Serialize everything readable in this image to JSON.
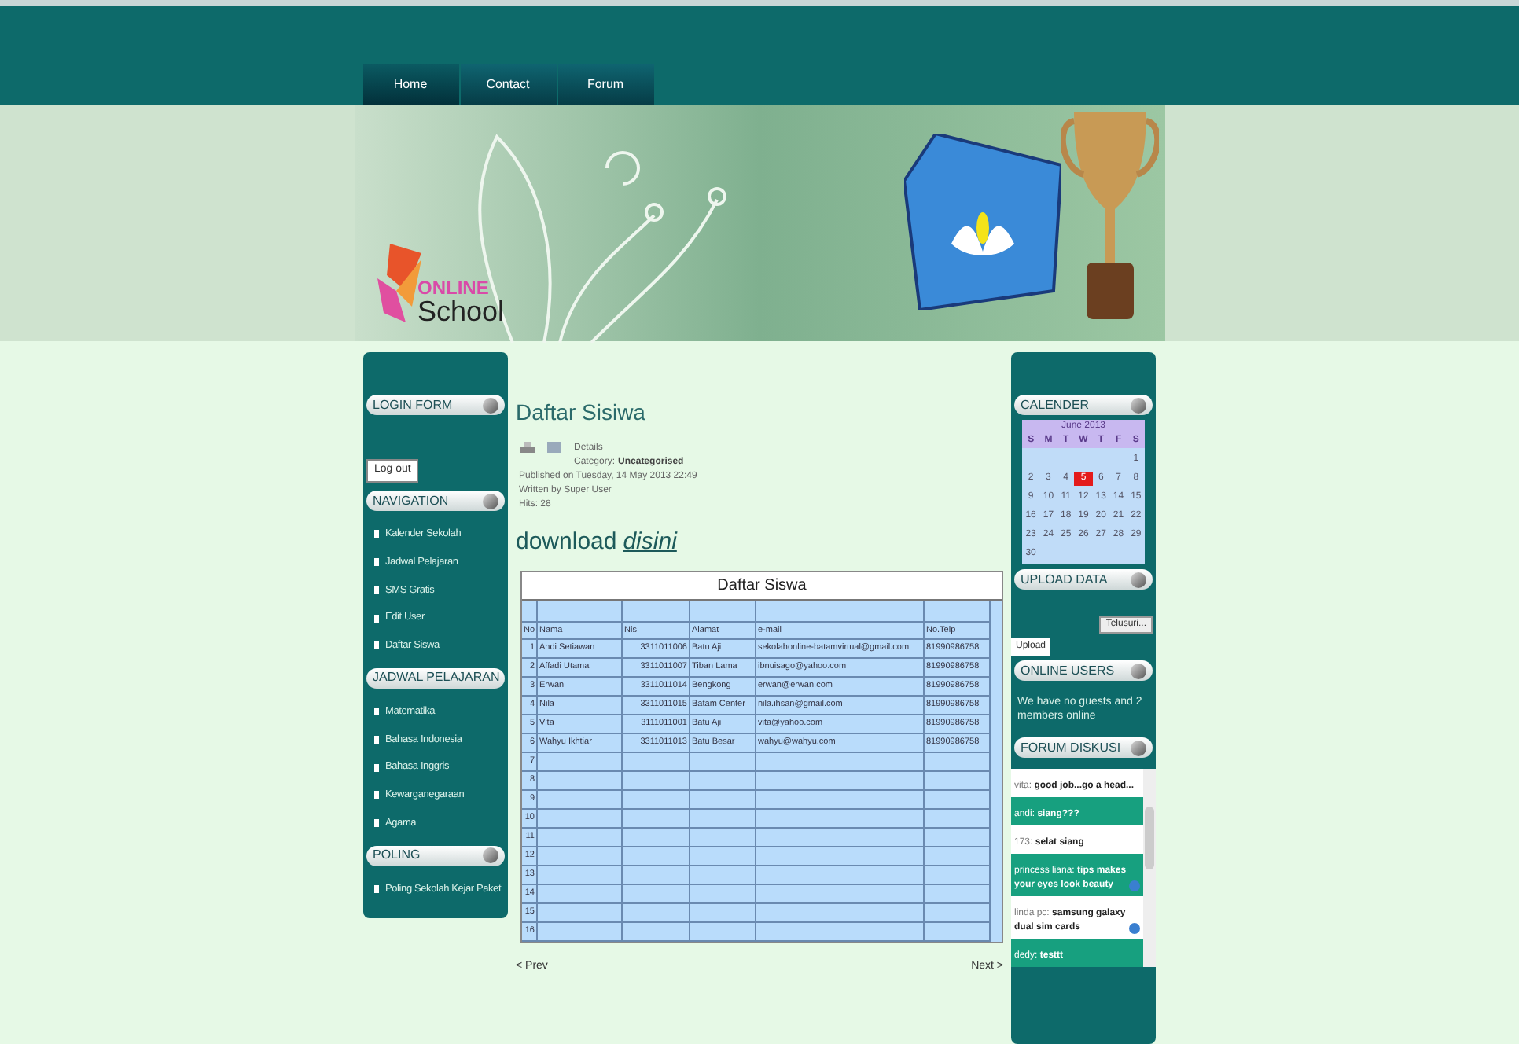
{
  "nav": [
    {
      "label": "Home",
      "selected": true
    },
    {
      "label": "Contact",
      "selected": false
    },
    {
      "label": "Forum",
      "selected": false
    }
  ],
  "logo": {
    "word_1": "ONLINE",
    "word_2": "School"
  },
  "left_modules": [
    {
      "title": "LOGIN FORM",
      "kind": "login",
      "button": "Log out"
    },
    {
      "title": "NAVIGATION",
      "kind": "links",
      "items": [
        "Kalender Sekolah",
        "Jadwal Pelajaran",
        "SMS Gratis",
        "Edit User",
        "Daftar Siswa"
      ]
    },
    {
      "title": "JADWAL PELAJARAN",
      "kind": "links",
      "items": [
        "Matematika",
        "Bahasa Indonesia",
        "Bahasa Inggris",
        "Kewarganegaraan",
        "Agama"
      ]
    },
    {
      "title": "POLING",
      "kind": "links",
      "items": [
        "Poling Sekolah Kejar Paket"
      ]
    }
  ],
  "article": {
    "title": "Daftar Sisiwa",
    "details_label": "Details",
    "category_label": "Category:",
    "category": "Uncategorised",
    "published": "Published on Tuesday, 14 May 2013 22:49",
    "author": "Written by Super User",
    "hits": "Hits: 28",
    "download_text": "download",
    "download_link": "disini"
  },
  "table": {
    "title": "Daftar Siswa",
    "columns": [
      "No",
      "Nama",
      "Nis",
      "Alamat",
      "e-mail",
      "No.Telp"
    ],
    "rows": [
      [
        "1",
        "Andi Setiawan",
        "3311011006",
        "Batu Aji",
        "sekolahonline-batamvirtual@gmail.com",
        "81990986758"
      ],
      [
        "2",
        "Affadi Utama",
        "3311011007",
        "Tiban Lama",
        "ibnuisago@yahoo.com",
        "81990986758"
      ],
      [
        "3",
        "Erwan",
        "3311011014",
        "Bengkong",
        "erwan@erwan.com",
        "81990986758"
      ],
      [
        "4",
        "Nila",
        "3311011015",
        "Batam Center",
        "nila.ihsan@gmail.com",
        "81990986758"
      ],
      [
        "5",
        "Vita",
        "3111011001",
        "Batu Aji",
        "vita@yahoo.com",
        "81990986758"
      ],
      [
        "6",
        "Wahyu Ikhtiar",
        "3311011013",
        "Batu Besar",
        "wahyu@wahyu.com",
        "81990986758"
      ],
      [
        "7"
      ],
      [
        "8"
      ],
      [
        "9"
      ],
      [
        "10"
      ],
      [
        "11"
      ],
      [
        "12"
      ],
      [
        "13"
      ],
      [
        "14"
      ],
      [
        "15"
      ],
      [
        "16"
      ]
    ]
  },
  "pager": {
    "prev": "< Prev",
    "next": "Next >"
  },
  "calendar": {
    "title": "CALENDER",
    "month": "June 2013",
    "weekdays": [
      "S",
      "M",
      "T",
      "W",
      "T",
      "F",
      "S"
    ],
    "weeks": [
      [
        {
          "label": "1",
          "selected": false
        }
      ],
      [
        {
          "label": "2",
          "selected": false
        },
        {
          "label": "3",
          "selected": false
        },
        {
          "label": "4",
          "selected": false
        },
        {
          "label": "5",
          "selected": true
        },
        {
          "label": "6",
          "selected": false
        },
        {
          "label": "7",
          "selected": false
        },
        {
          "label": "8",
          "selected": false
        }
      ],
      [
        {
          "label": "9",
          "selected": false
        },
        {
          "label": "10",
          "selected": false
        },
        {
          "label": "11",
          "selected": false
        },
        {
          "label": "12",
          "selected": false
        },
        {
          "label": "13",
          "selected": false
        },
        {
          "label": "14",
          "selected": false
        },
        {
          "label": "15",
          "selected": false
        }
      ],
      [
        {
          "label": "16",
          "selected": false
        },
        {
          "label": "17",
          "selected": false
        },
        {
          "label": "18",
          "selected": false
        },
        {
          "label": "19",
          "selected": false
        },
        {
          "label": "20",
          "selected": false
        },
        {
          "label": "21",
          "selected": false
        },
        {
          "label": "22",
          "selected": false
        }
      ],
      [
        {
          "label": "23",
          "selected": false
        },
        {
          "label": "24",
          "selected": false
        },
        {
          "label": "25",
          "selected": false
        },
        {
          "label": "26",
          "selected": false
        },
        {
          "label": "27",
          "selected": false
        },
        {
          "label": "28",
          "selected": false
        },
        {
          "label": "29",
          "selected": false
        }
      ],
      [
        {
          "label": "30",
          "selected": false
        }
      ]
    ]
  },
  "upload": {
    "title": "UPLOAD DATA",
    "browse_button": "Telusuri...",
    "submit_button": "Upload"
  },
  "online_users": {
    "title": "ONLINE USERS",
    "text": "We have no guests and 2 members online"
  },
  "forum": {
    "title": "FORUM DISKUSI",
    "messages": [
      {
        "name": "vita:",
        "text": "good job...go a head..."
      },
      {
        "name": "andi:",
        "text": "siang???"
      },
      {
        "name": "173:",
        "text": "selat siang"
      },
      {
        "name": "princess liana:",
        "text": "tips makes your eyes look beauty",
        "emoji": true
      },
      {
        "name": "linda pc:",
        "text": "samsung galaxy dual sim cards",
        "emoji": true
      },
      {
        "name": "dedy:",
        "text": "testtt"
      }
    ]
  }
}
